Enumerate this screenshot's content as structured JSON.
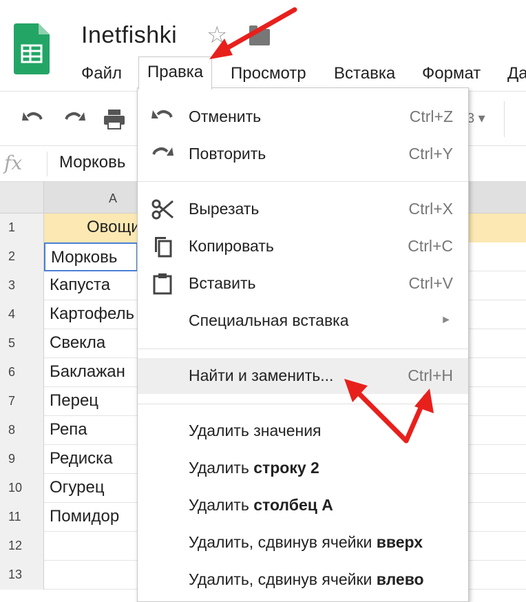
{
  "app": {
    "title": "Inetfishki"
  },
  "menubar": {
    "items": [
      {
        "label": "Файл"
      },
      {
        "label": "Правка"
      },
      {
        "label": "Просмотр"
      },
      {
        "label": "Вставка"
      },
      {
        "label": "Формат"
      },
      {
        "label": "Да"
      }
    ]
  },
  "toolbar": {
    "font_size_partial": "3 ▾"
  },
  "formula_bar": {
    "fx": "fx",
    "value": "Морковь"
  },
  "grid": {
    "column_header": "A",
    "rows": [
      {
        "num": "1",
        "value": "Овощи"
      },
      {
        "num": "2",
        "value": "Морковь"
      },
      {
        "num": "3",
        "value": "Капуста"
      },
      {
        "num": "4",
        "value": "Картофель"
      },
      {
        "num": "5",
        "value": "Свекла"
      },
      {
        "num": "6",
        "value": "Баклажан"
      },
      {
        "num": "7",
        "value": "Перец"
      },
      {
        "num": "8",
        "value": "Репа"
      },
      {
        "num": "9",
        "value": "Редиска"
      },
      {
        "num": "10",
        "value": "Огурец"
      },
      {
        "num": "11",
        "value": "Помидор"
      },
      {
        "num": "12",
        "value": ""
      },
      {
        "num": "13",
        "value": ""
      }
    ]
  },
  "edit_menu": {
    "undo": {
      "label": "Отменить",
      "shortcut": "Ctrl+Z"
    },
    "redo": {
      "label": "Повторить",
      "shortcut": "Ctrl+Y"
    },
    "cut": {
      "label": "Вырезать",
      "shortcut": "Ctrl+X"
    },
    "copy": {
      "label": "Копировать",
      "shortcut": "Ctrl+C"
    },
    "paste": {
      "label": "Вставить",
      "shortcut": "Ctrl+V"
    },
    "paste_special": {
      "label": "Специальная вставка",
      "arrow": "►"
    },
    "find_replace": {
      "label": "Найти и заменить...",
      "shortcut": "Ctrl+H"
    },
    "delete_values": {
      "label": "Удалить значения"
    },
    "delete_row": {
      "prefix": "Удалить ",
      "bold": "строку 2"
    },
    "delete_col": {
      "prefix": "Удалить ",
      "bold": "столбец A"
    },
    "delete_shift_up": {
      "prefix": "Удалить, сдвинув ячейки ",
      "bold": "вверх"
    },
    "delete_shift_left": {
      "prefix": "Удалить, сдвинув ячейки ",
      "bold": "влево"
    }
  },
  "colors": {
    "annotation_arrow": "#e8201c",
    "header_cell_bg": "#fce8b2",
    "selection_border": "#4a7fd6",
    "sheets_green": "#23a566"
  }
}
